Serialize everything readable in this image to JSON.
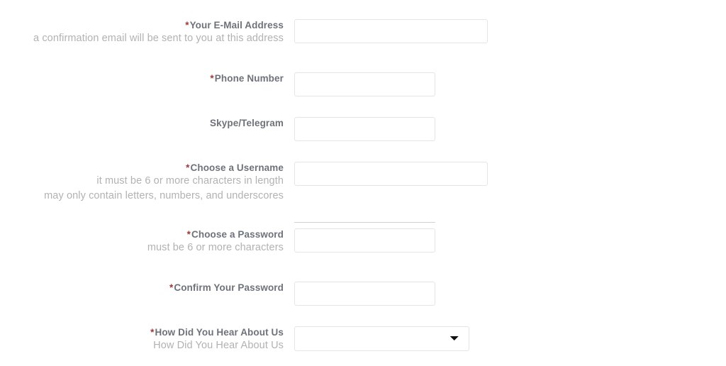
{
  "form": {
    "required_marker": "*",
    "accent_required_color": "#9d3a3a",
    "label_color": "#6e7279",
    "help_color": "#b2b2b2",
    "border_color": "#e3e5e6",
    "fields": {
      "email": {
        "label": "Your E-Mail Address",
        "required": true,
        "help": "a confirmation email will be sent to you at this address",
        "value": "",
        "placeholder": ""
      },
      "phone": {
        "label": "Phone Number",
        "required": true,
        "help": "",
        "value": "",
        "placeholder": ""
      },
      "skype": {
        "label": "Skype/Telegram",
        "required": false,
        "help": "",
        "value": "",
        "placeholder": ""
      },
      "username": {
        "label": "Choose a Username",
        "required": true,
        "help_line1": "it must be 6 or more characters in length",
        "help_line2": "may only contain letters, numbers, and underscores",
        "value": "",
        "placeholder": ""
      },
      "password": {
        "label": "Choose a Password",
        "required": true,
        "help": "must be 6 or more characters",
        "value": "",
        "placeholder": ""
      },
      "confirm_password": {
        "label": "Confirm Your Password",
        "required": true,
        "help": "",
        "value": "",
        "placeholder": ""
      },
      "referral": {
        "label": "How Did You Hear About Us",
        "required": true,
        "help": "How Did You Hear About Us",
        "selected_option": "",
        "options": [
          ""
        ],
        "dropdown_icon": "chevron-down-icon"
      }
    }
  }
}
